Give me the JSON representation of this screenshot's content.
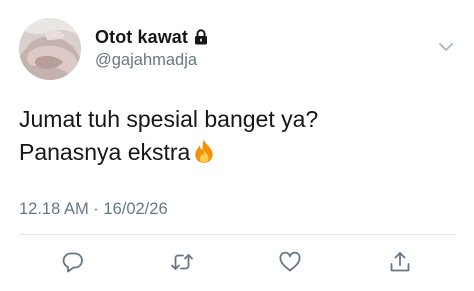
{
  "tweet": {
    "author": {
      "display_name": "Otot kawat",
      "handle": "@gajahmadja",
      "protected_icon": "lock-icon",
      "avatar_icon": "profile-photo"
    },
    "text": {
      "line1": "Jumat tuh spesial banget ya?",
      "line2": "Panasnya ekstra",
      "emoji_icon": "fire-icon"
    },
    "meta": {
      "time": "12.18 AM",
      "separator": " · ",
      "date": "16/02/26"
    },
    "actions": {
      "reply_icon": "reply-icon",
      "retweet_icon": "retweet-icon",
      "like_icon": "heart-icon",
      "share_icon": "share-icon"
    },
    "menu_icon": "chevron-down-icon"
  },
  "colors": {
    "primary_text": "#14171a",
    "secondary_text": "#657786",
    "icon": "#657786",
    "divider": "#e1e8ed",
    "fire_outer": "#f4900c",
    "fire_inner": "#ffcc4d"
  }
}
